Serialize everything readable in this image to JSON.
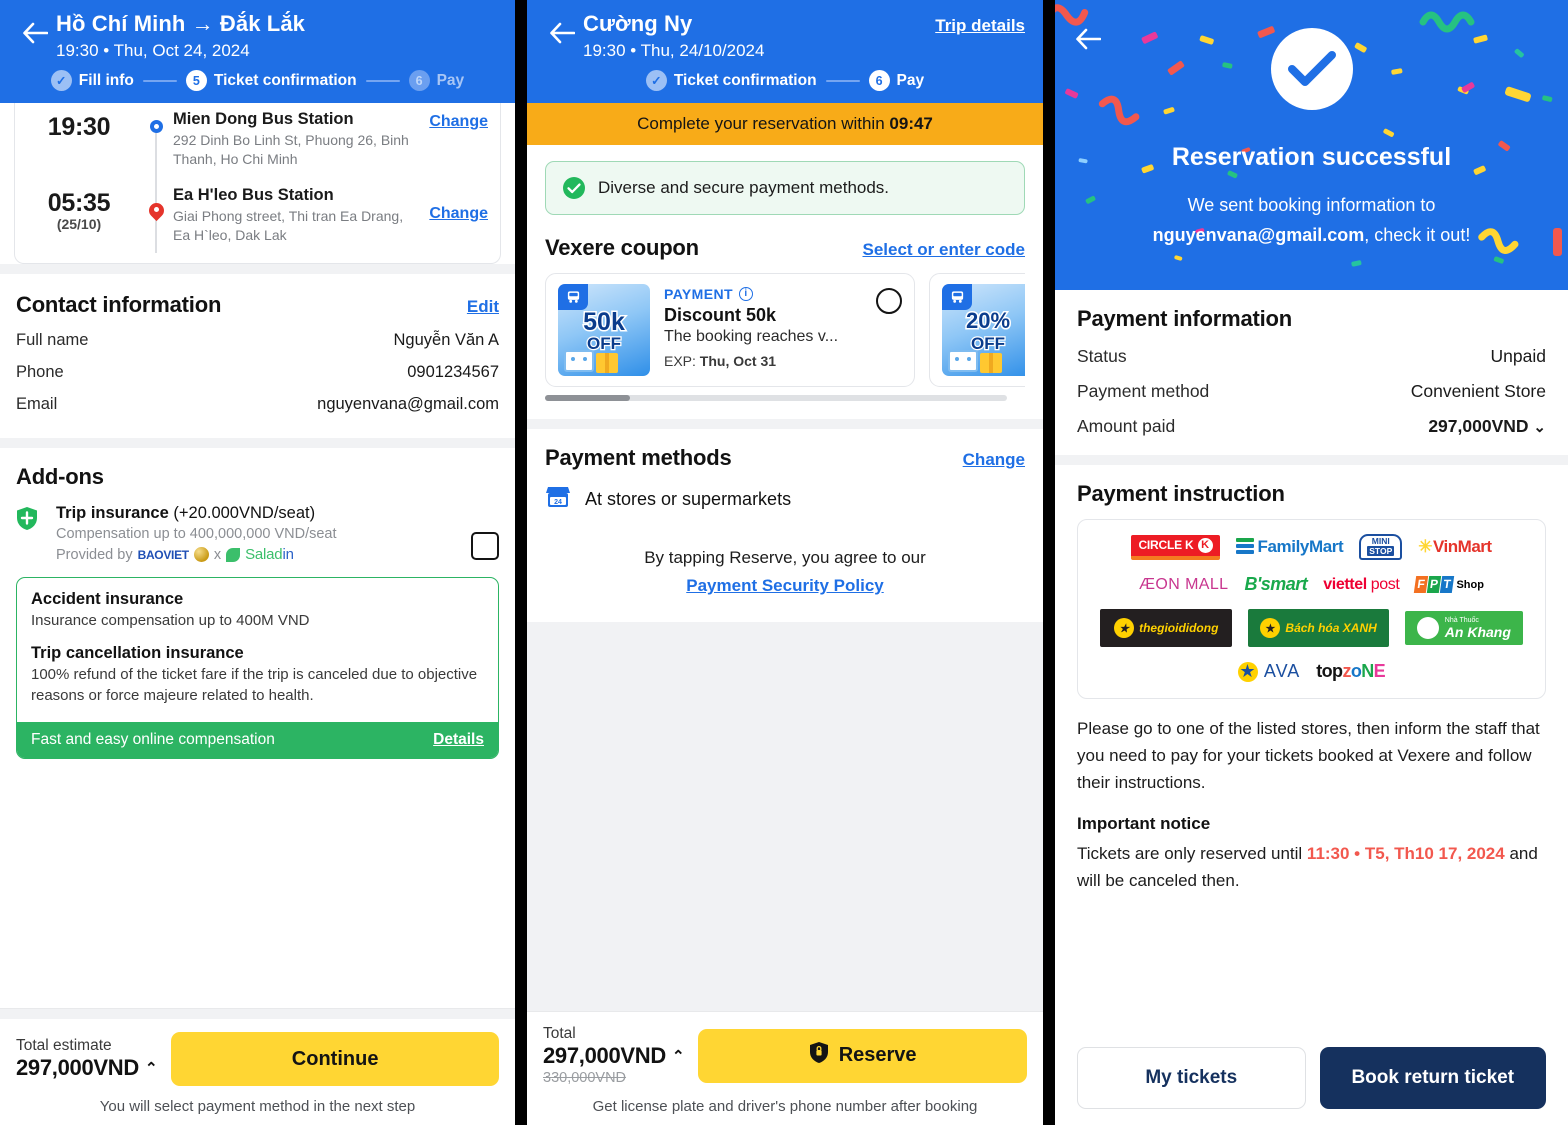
{
  "panel1": {
    "header": {
      "back_icon": "arrow-left-icon",
      "title": "Hồ Chí Minh → Đắk Lắk",
      "subtitle": "19:30 • Thu, Oct 24, 2024",
      "steps": [
        {
          "num": "✓",
          "label": "Fill info",
          "state": "done"
        },
        {
          "num": "5",
          "label": "Ticket confirmation",
          "state": "cur"
        },
        {
          "num": "6",
          "label": "Pay",
          "state": "todo"
        }
      ]
    },
    "trip": {
      "legs": [
        {
          "time": "19:30",
          "date": "",
          "station": "Mien Dong Bus Station",
          "address": "292 Dinh Bo Linh St, Phuong 26, Binh Thanh, Ho Chi Minh",
          "change_label": "Change"
        },
        {
          "time": "05:35",
          "date": "(25/10)",
          "station": "Ea H'leo Bus Station",
          "address": "Giai Phong street, Thi tran Ea Drang, Ea H`leo, Dak Lak",
          "change_label": "Change"
        }
      ]
    },
    "contact": {
      "title": "Contact information",
      "edit_label": "Edit",
      "rows": [
        {
          "key": "Full name",
          "value": "Nguyễn Văn A"
        },
        {
          "key": "Phone",
          "value": "0901234567"
        },
        {
          "key": "Email",
          "value": "nguyenvana@gmail.com"
        }
      ]
    },
    "addons": {
      "title": "Add-ons",
      "insurance_name": "Trip insurance",
      "insurance_price": "(+20.000VND/seat)",
      "insurance_sub": "Compensation up to 400,000,000 VND/seat",
      "provided_label": "Provided by",
      "provider_1": "BAOVIET",
      "provider_sep": "x",
      "provider_2a": "Salad",
      "provider_2b": "in",
      "details_card": {
        "h1": "Accident insurance",
        "p1": "Insurance compensation up to 400M VND",
        "h2": "Trip cancellation insurance",
        "p2": "100% refund of the ticket fare if the trip is canceled due to objective reasons or force majeure related to health.",
        "footer_text": "Fast and easy online compensation",
        "footer_link": "Details"
      }
    },
    "footer": {
      "total_label": "Total estimate",
      "total_amount": "297,000VND",
      "caret": "⌃",
      "cta": "Continue",
      "note": "You will select payment method in the next step"
    }
  },
  "panel2": {
    "header": {
      "back_icon": "arrow-left-icon",
      "title": "Cường Ny",
      "subtitle": "19:30 • Thu, 24/10/2024",
      "trip_details": "Trip details",
      "steps": [
        {
          "num": "✓",
          "label": "Ticket confirmation",
          "state": "done"
        },
        {
          "num": "6",
          "label": "Pay",
          "state": "cur"
        }
      ]
    },
    "countdown": {
      "prefix": "Complete your reservation within",
      "time": "09:47"
    },
    "secure_notice": "Diverse and secure payment methods.",
    "coupon": {
      "title": "Vexere coupon",
      "link": "Select or enter code",
      "cards": [
        {
          "badge_amount": "50k",
          "badge_off": "OFF",
          "tag": "PAYMENT",
          "name": "Discount 50k",
          "desc": "The booking reaches v...",
          "exp_label": "EXP:",
          "exp_value": "Thu, Oct 31"
        },
        {
          "badge_amount": "20%",
          "badge_off": "OFF"
        }
      ]
    },
    "payment_methods": {
      "title": "Payment methods",
      "change_label": "Change",
      "selected": "At stores or supermarkets",
      "agree_text": "By tapping Reserve, you agree to our",
      "policy_link": "Payment Security Policy"
    },
    "footer": {
      "total_label": "Total",
      "total_amount": "297,000VND",
      "caret": "⌃",
      "old_amount": "330,000VND",
      "cta": "Reserve",
      "cta_icon": "lock-shield-icon",
      "note": "Get license plate and driver's phone number after booking"
    }
  },
  "panel3": {
    "hero": {
      "back_icon": "arrow-left-icon",
      "check_icon": "check-circle-icon",
      "title": "Reservation successful",
      "line1": "We sent booking information to",
      "email": "nguyenvana@gmail.com",
      "line2": ", check it out!"
    },
    "payment_information": {
      "title": "Payment information",
      "rows": [
        {
          "key": "Status",
          "value": "Unpaid",
          "style": "unpaid"
        },
        {
          "key": "Payment method",
          "value": "Convenient Store",
          "style": ""
        },
        {
          "key": "Amount paid",
          "value": "297,000VND",
          "style": "caret"
        }
      ],
      "caret": "⌄"
    },
    "payment_instruction": {
      "title": "Payment instruction",
      "stores": [
        [
          "CIRCLE K",
          "FamilyMart",
          "MINI STOP",
          "VinMart"
        ],
        [
          "ÆON MALL",
          "B'smart",
          "viettel post",
          "FPT Shop"
        ],
        [
          "thegioididong",
          "Bách hóa XANH",
          "An Khang"
        ],
        [
          "AVA",
          "topzone"
        ]
      ],
      "instruction": "Please go to one of the listed stores, then inform the staff that you need to pay for your tickets booked at Vexere and follow their instructions.",
      "notice_title": "Important notice",
      "notice_prefix": "Tickets are only reserved until ",
      "notice_highlight": "11:30 • T5, Th10 17, 2024",
      "notice_suffix": " and will be canceled then."
    },
    "footer": {
      "secondary": "My tickets",
      "primary": "Book return ticket"
    }
  },
  "colors": {
    "brand_blue": "#1f6fe5",
    "accent_yellow": "#ffd633",
    "amber": "#f8ab18",
    "green": "#2cb463",
    "red": "#f2584e",
    "navy": "#15315e"
  }
}
